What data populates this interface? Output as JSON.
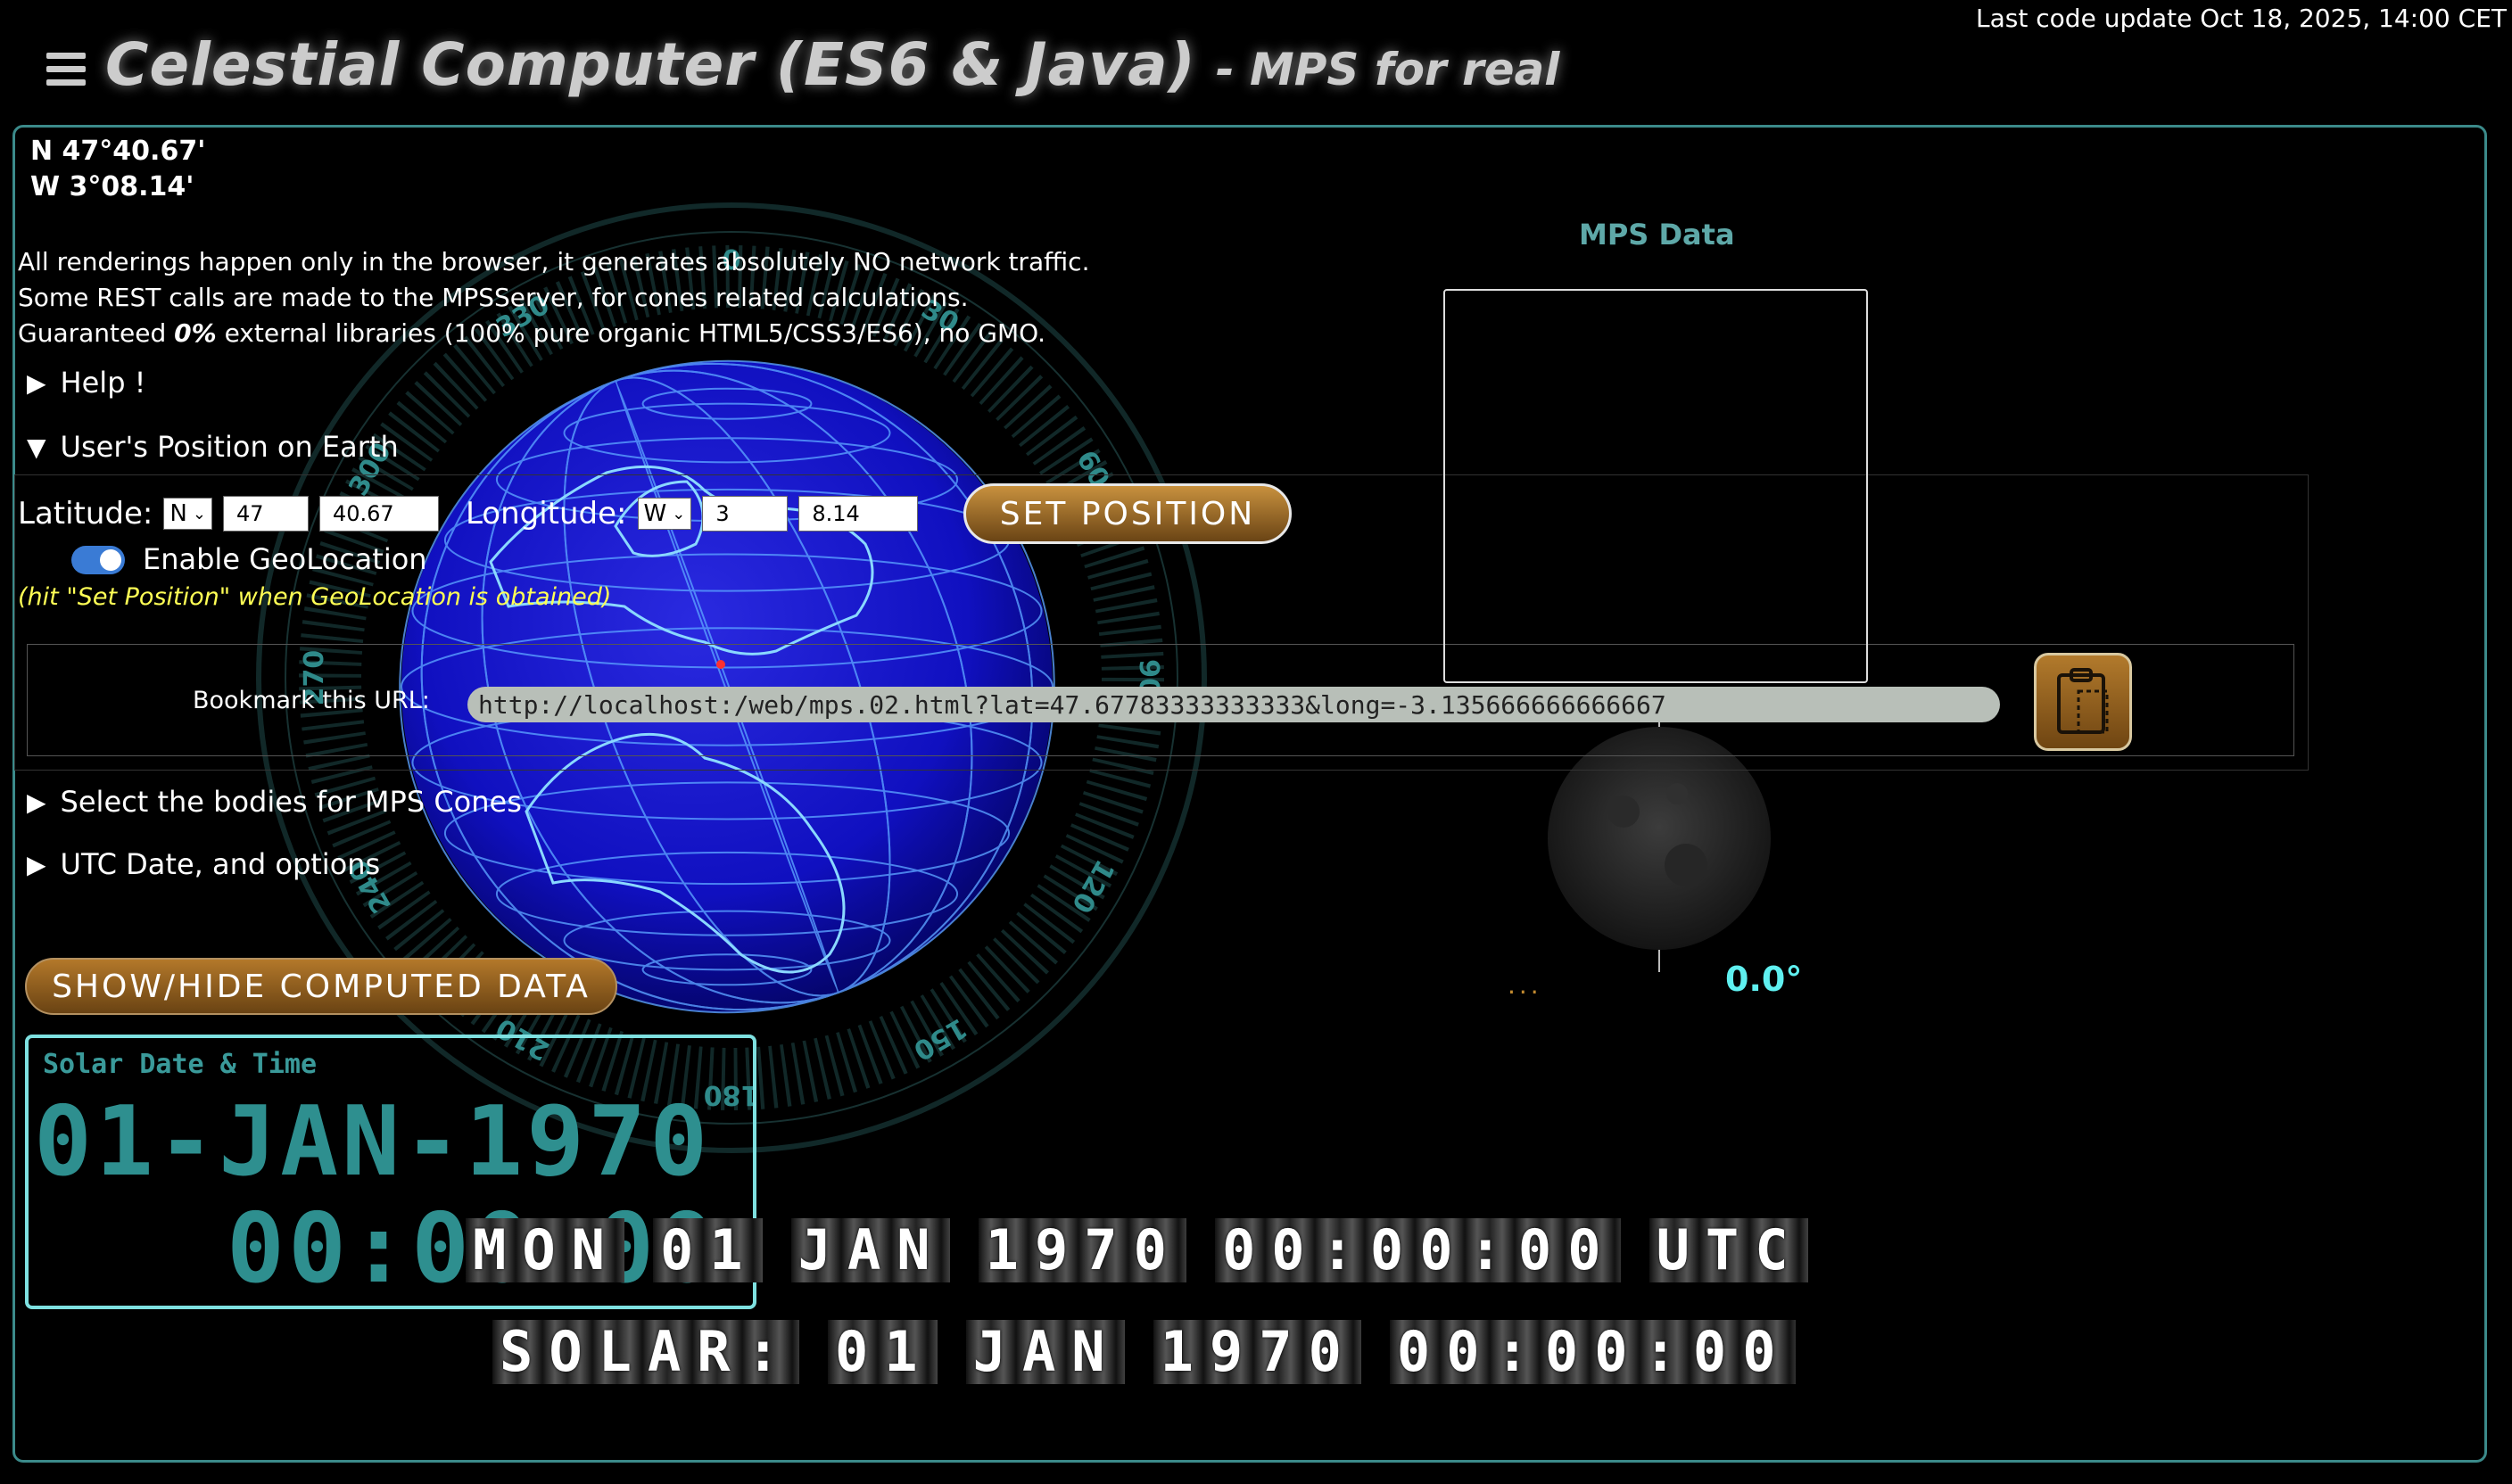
{
  "last_update": "Last code update Oct 18, 2025, 14:00 CET",
  "header": {
    "title": "Celestial Computer (ES6 & Java)",
    "subtitle": "- MPS for real"
  },
  "position_display": {
    "lat": "N 47°40.67'",
    "lng": "W 3°08.14'"
  },
  "intro": {
    "line1": "All renderings happen only in the browser, it generates absolutely NO network traffic.",
    "line2": "Some REST calls are made to the MPSServer, for cones related calculations.",
    "line3_pre": "Guaranteed ",
    "line3_bold": "0%",
    "line3_post": " external libraries (100% pure organic HTML5/CSS3/ES6), no GMO."
  },
  "sections": {
    "help": "Help !",
    "user_position": "User's Position on Earth",
    "bodies": "Select the bodies for MPS Cones",
    "utc": "UTC Date, and options"
  },
  "form": {
    "latitude_label": "Latitude:",
    "lat_hemisphere": "N",
    "lat_degrees": "47",
    "lat_minutes": "40.67",
    "longitude_label": "Longitude:",
    "lng_hemisphere": "W",
    "lng_degrees": "3",
    "lng_minutes": "8.14",
    "set_position_label": "SET POSITION",
    "geolocation_label": "Enable GeoLocation",
    "geolocation_enabled": true,
    "geolocation_hint": "(hit \"Set Position\" when GeoLocation is obtained)",
    "bookmark_label": "Bookmark this URL:",
    "bookmark_url": "http://localhost:/web/mps.02.html?lat=47.67783333333333&long=-3.135666666666667"
  },
  "show_hide_label": "SHOW/HIDE COMPUTED DATA",
  "solar_card": {
    "title": "Solar Date & Time",
    "date": "01-JAN-1970",
    "time": "00:00:00"
  },
  "flap_utc": [
    "MON",
    "01",
    "JAN",
    "1970",
    "00:00:00",
    "UTC"
  ],
  "flap_solar": [
    "SOLAR:",
    "01",
    "JAN",
    "1970",
    "00:00:00"
  ],
  "mps": {
    "title": "MPS Data",
    "moon_angle": "0.0°",
    "dots": "..."
  },
  "compass_labels": [
    "0",
    "30",
    "60",
    "90",
    "120",
    "150",
    "180",
    "210",
    "240",
    "270",
    "300",
    "330"
  ],
  "colors": {
    "accent": "#3b8a8a",
    "globe": "#1010c8",
    "button_gold": "#b3782a",
    "teal_text": "#2e8f8f",
    "hint_yellow": "#ffff55"
  }
}
